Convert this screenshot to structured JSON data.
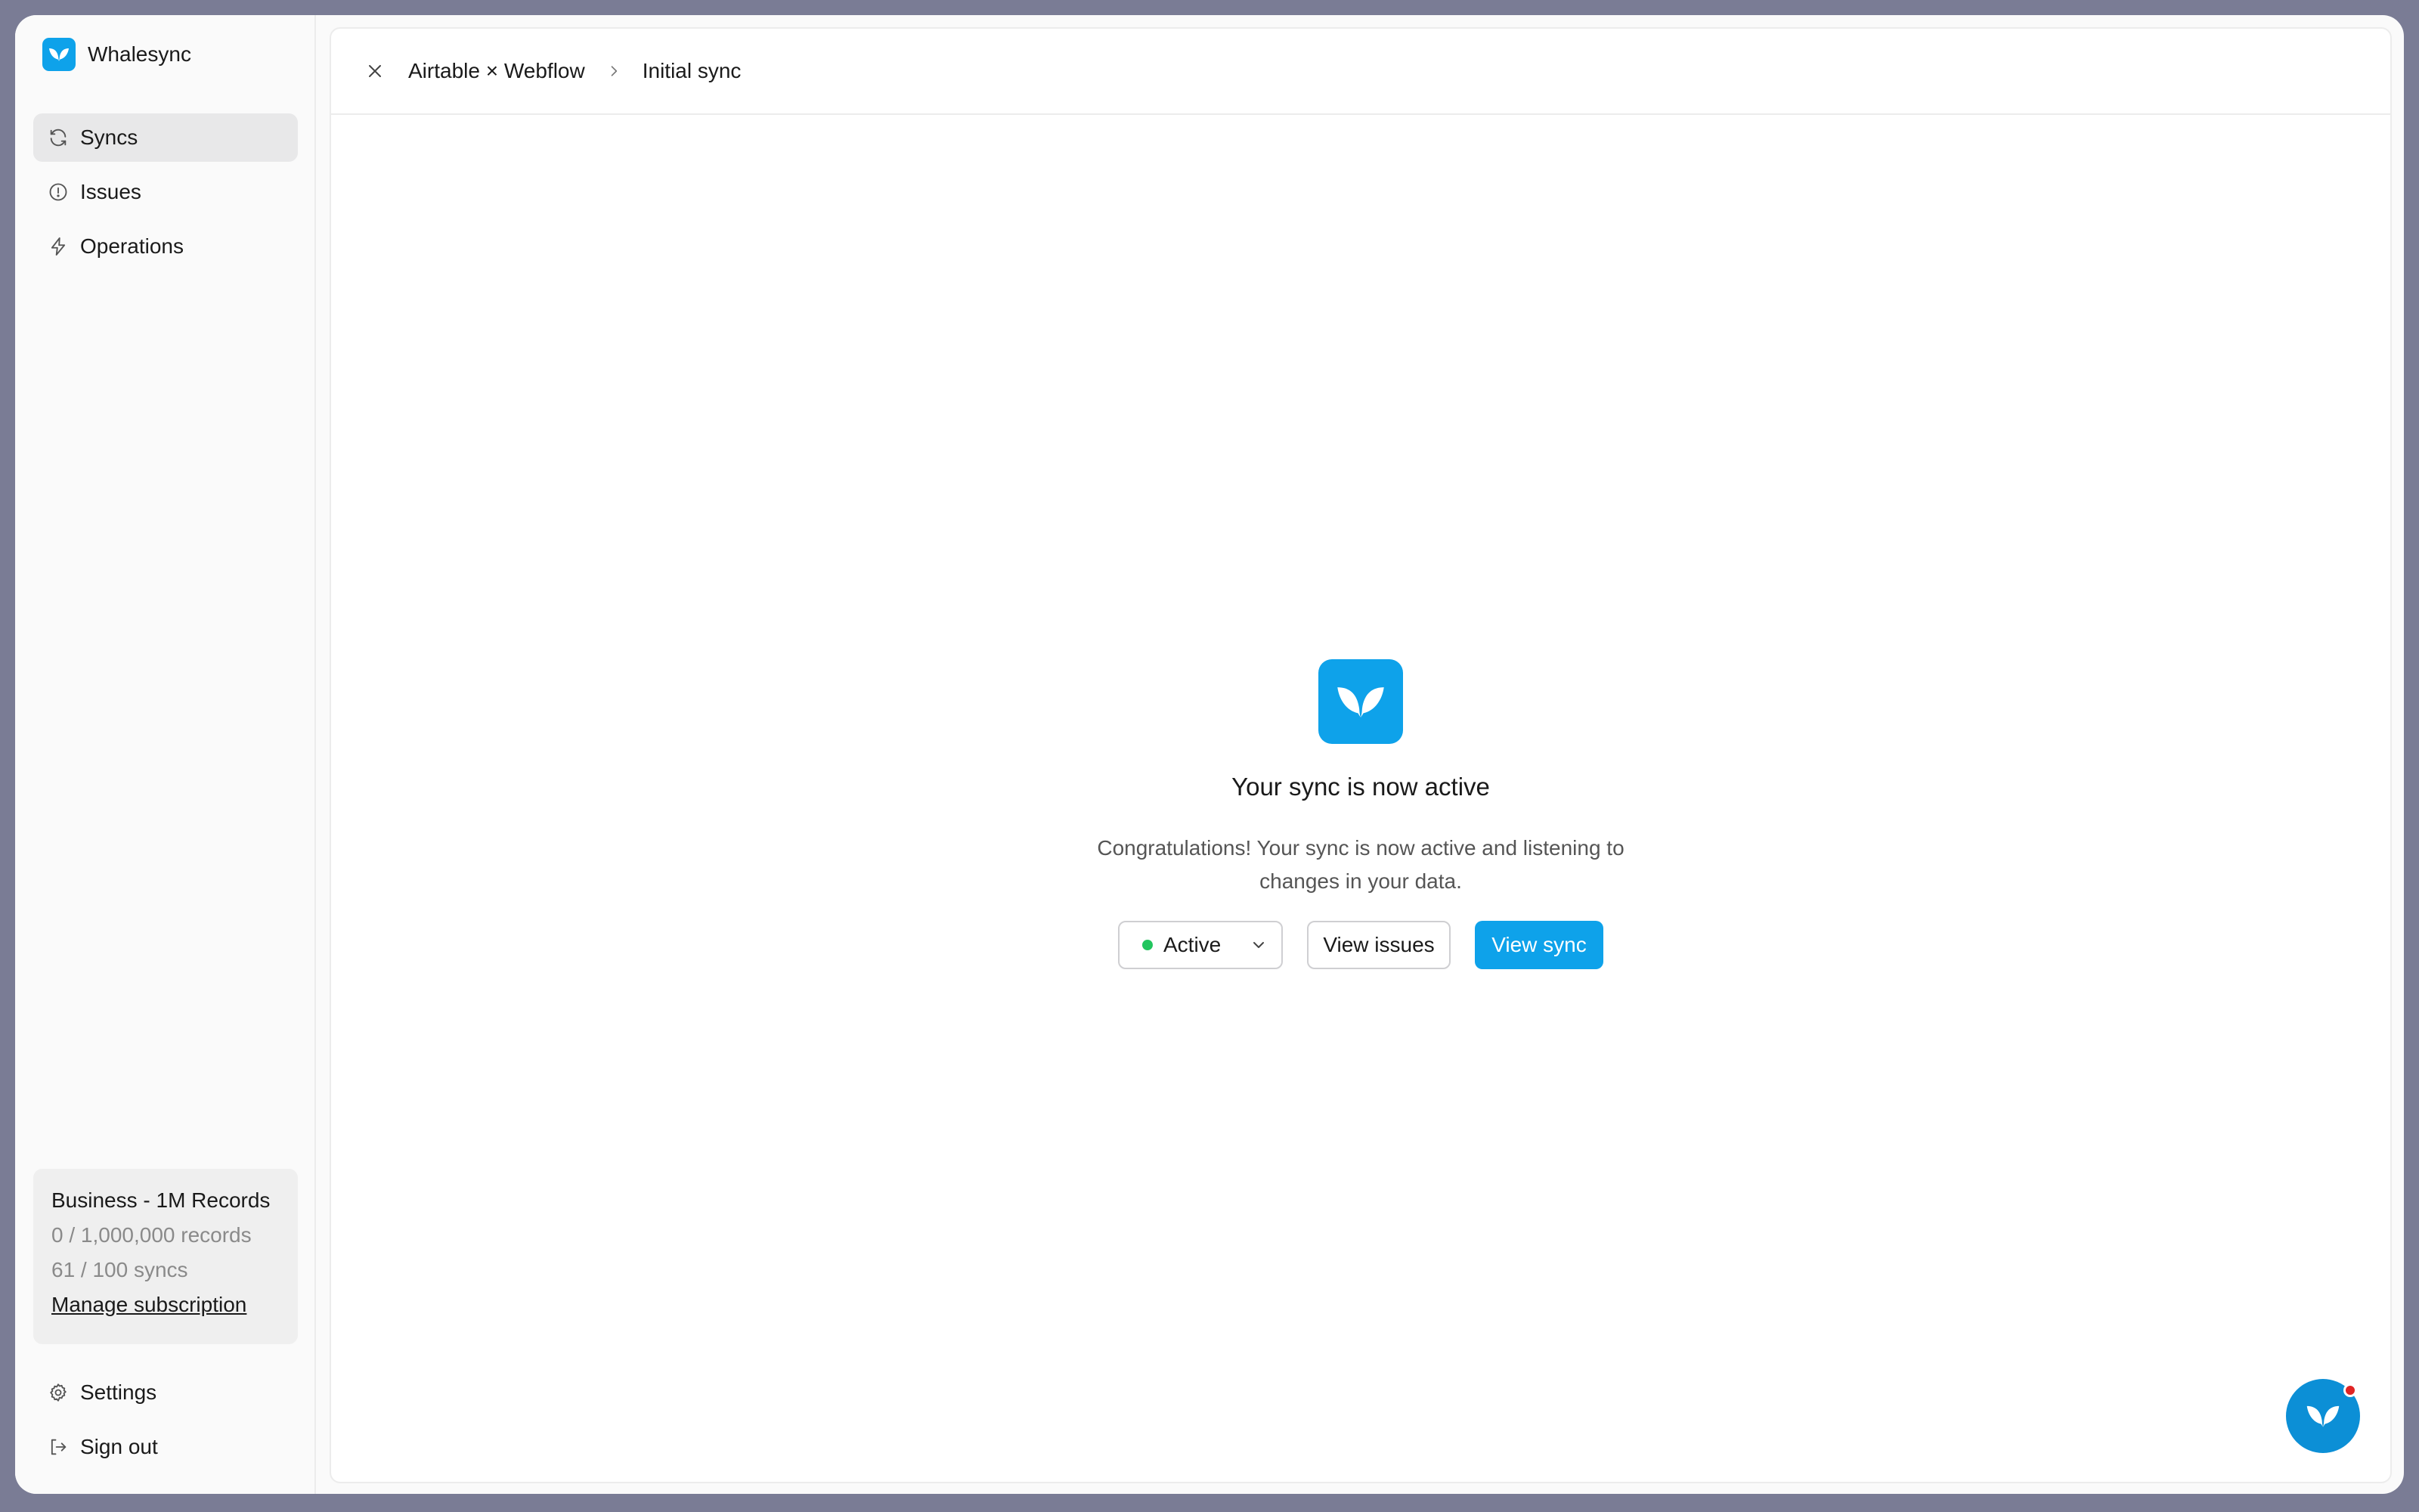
{
  "app": {
    "name": "Whalesync",
    "logo_icon": "whalesync-tail-icon",
    "accent_color": "#0ea2ea"
  },
  "sidebar": {
    "items": [
      {
        "label": "Syncs",
        "icon": "refresh-icon",
        "active": true
      },
      {
        "label": "Issues",
        "icon": "alert-circle-icon",
        "active": false
      },
      {
        "label": "Operations",
        "icon": "lightning-icon",
        "active": false
      }
    ],
    "plan": {
      "title": "Business - 1M Records",
      "records": "0 / 1,000,000 records",
      "syncs": "61 / 100 syncs",
      "manage_label": "Manage subscription"
    },
    "footer": [
      {
        "label": "Settings",
        "icon": "gear-icon"
      },
      {
        "label": "Sign out",
        "icon": "sign-out-icon"
      }
    ]
  },
  "header": {
    "close_icon": "close-icon",
    "breadcrumb": [
      "Airtable × Webflow",
      "Initial sync"
    ]
  },
  "main": {
    "title": "Your sync is now active",
    "description": "Congratulations! Your sync is now active and listening to changes in your data.",
    "status_select": {
      "value": "Active",
      "status_color": "#22c55e"
    },
    "view_issues_label": "View issues",
    "view_sync_label": "View sync"
  },
  "chat": {
    "icon": "whalesync-tail-icon",
    "notification_color": "#e02424"
  }
}
